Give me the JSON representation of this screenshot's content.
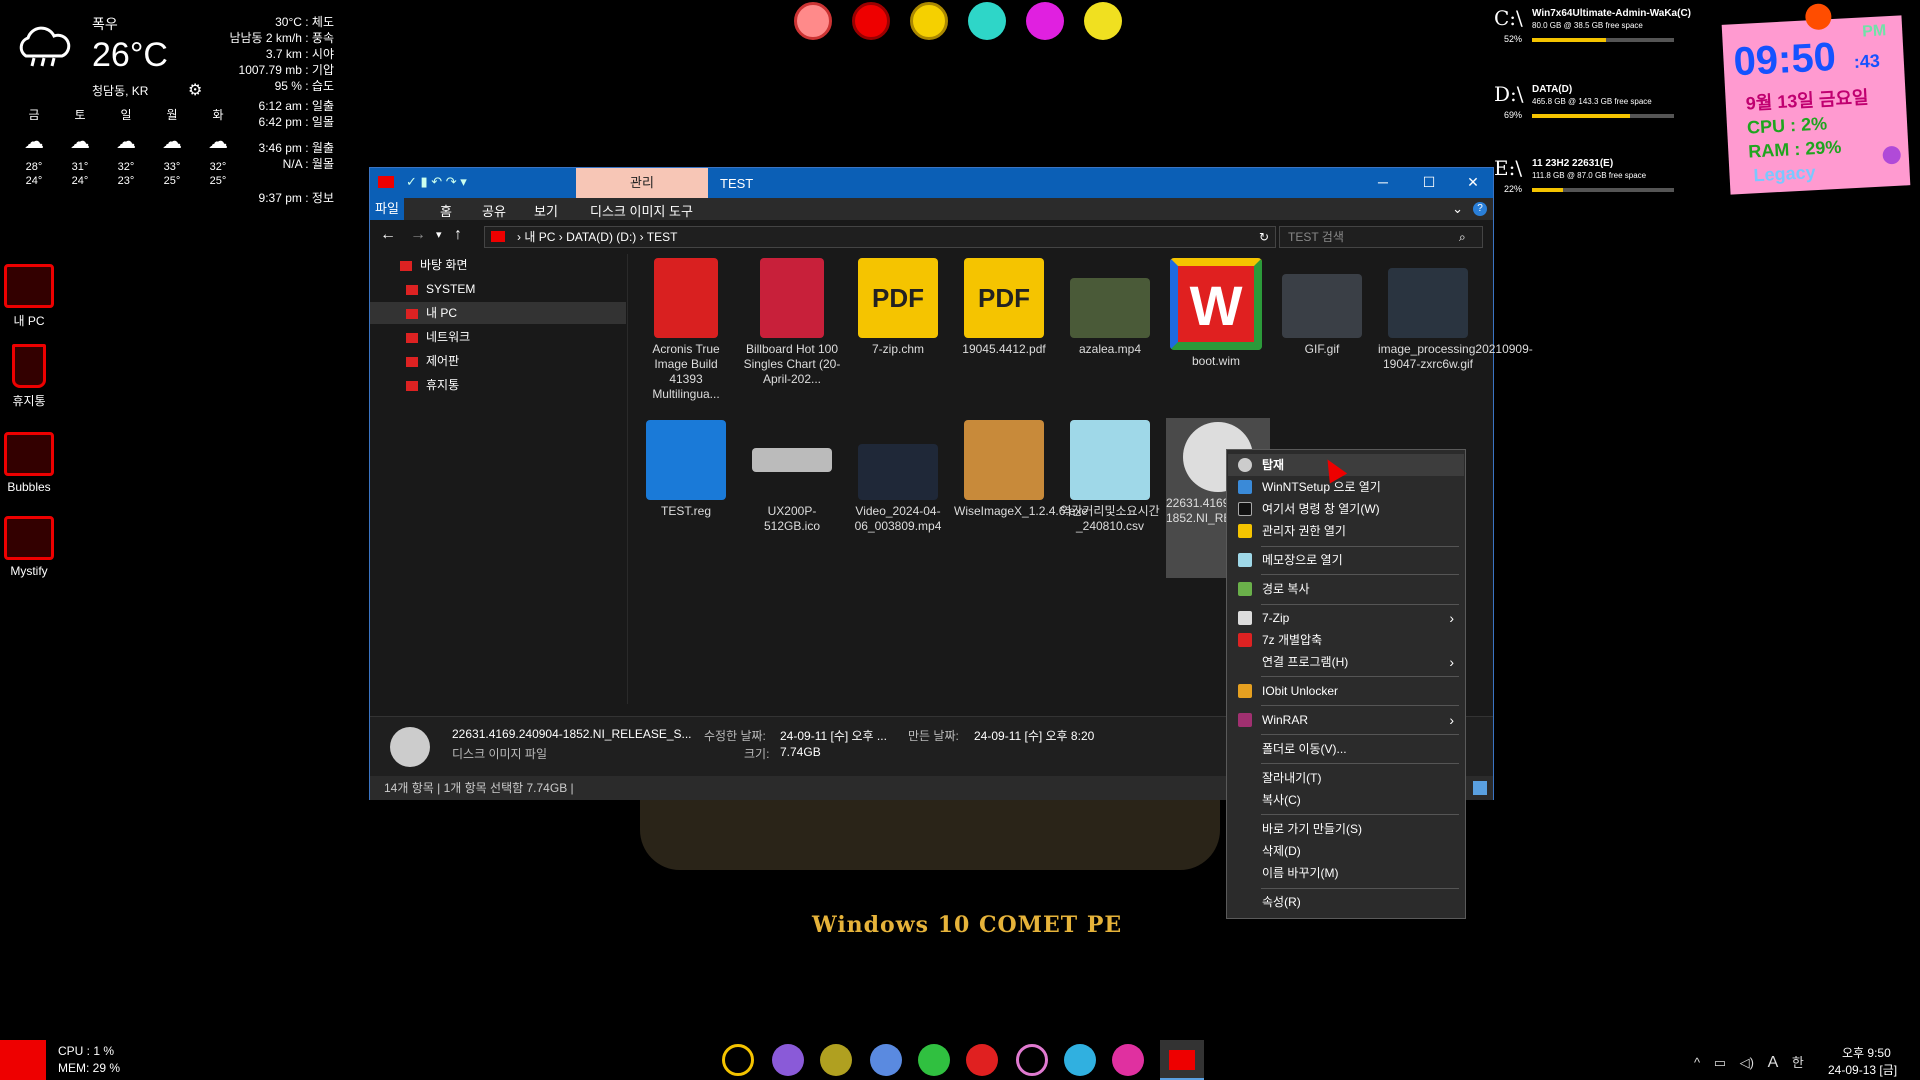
{
  "weather": {
    "condition": "폭우",
    "temperature": "26°C",
    "location": "청담동, KR",
    "details": [
      "30°C : 체도",
      "남남동 2 km/h : 풍속",
      "3.7 km : 시야",
      "1007.79 mb : 기압",
      "95 % : 습도"
    ],
    "sun": [
      "6:12 am : 일출",
      "6:42 pm : 일몰",
      "3:46 pm : 월출",
      "N/A : 월몰",
      "9:37 pm : 정보"
    ],
    "forecast": [
      {
        "day": "금",
        "high": "28°",
        "low": "24°"
      },
      {
        "day": "토",
        "high": "31°",
        "low": "24°"
      },
      {
        "day": "일",
        "high": "32°",
        "low": "23°"
      },
      {
        "day": "월",
        "high": "33°",
        "low": "25°"
      },
      {
        "day": "화",
        "high": "32°",
        "low": "25°"
      }
    ]
  },
  "desktop_icons": [
    "내 PC",
    "휴지통",
    "Bubbles",
    "Mystify"
  ],
  "drives": [
    {
      "letter": "C:\\",
      "name": "Win7x64Ultimate-Admin-WaKa(C)",
      "space": "80.0 GB @ 38.5 GB free space",
      "pct": "52%",
      "fill": 0.52
    },
    {
      "letter": "D:\\",
      "name": "DATA(D)",
      "space": "465.8 GB @ 143.3 GB free space",
      "pct": "69%",
      "fill": 0.69
    },
    {
      "letter": "E:\\",
      "name": "11 23H2 22631(E)",
      "space": "111.8 GB @ 87.0 GB free space",
      "pct": "22%",
      "fill": 0.22
    }
  ],
  "sticky": {
    "time": "09:50",
    "ampm": "PM",
    "seconds": ":43",
    "date": "9월 13일 금요일",
    "cpu": "CPU : 2%",
    "ram": "RAM : 29%",
    "theme": "Legacy"
  },
  "window": {
    "manage_tab": "관리",
    "title": "TEST",
    "ribbon_tabs": [
      "파일",
      "홈",
      "공유",
      "보기",
      "디스크 이미지 도구"
    ],
    "breadcrumb": [
      "내 PC",
      "DATA(D) (D:)",
      "TEST"
    ],
    "search_placeholder": "TEST 검색",
    "nav": [
      "바탕 화면",
      "SYSTEM",
      "내 PC",
      "네트워크",
      "제어판",
      "휴지통"
    ],
    "files": [
      "Acronis True Image Build 41393 Multilingua...",
      "Billboard Hot 100 Singles Chart (20-April-202...",
      "7-zip.chm",
      "19045.4412.pdf",
      "azalea.mp4",
      "boot.wim",
      "GIF.gif",
      "image_processing20210909-19047-zxrc6w.gif",
      "TEST.reg",
      "UX200P-512GB.ico",
      "Video_2024-04-06_003809.mp4",
      "WiseImageX_1.2.4.6.exe",
      "역간거리및소요시간_240810.csv",
      "22631.4169.240904-1852.NI_RELEASE_SVC_PROD1_CLIENT..."
    ],
    "details": {
      "name": "22631.4169.240904-1852.NI_RELEASE_S...",
      "type": "디스크 이미지 파일",
      "modified_label": "수정한 날짜:",
      "modified": "24-09-11 [수] 오후 ...",
      "created_label": "만든 날짜:",
      "created": "24-09-11 [수] 오후 8:20",
      "size_label": "크기:",
      "size": "7.74GB"
    },
    "status": "14개 항목  |  1개 항목 선택함 7.74GB  |"
  },
  "context_menu": [
    "탑재",
    "WinNTSetup 으로 열기",
    "여기서 명령 창 열기(W)",
    "관리자 권한 열기",
    "메모장으로 열기",
    "경로 복사",
    "7-Zip",
    "7z 개별압축",
    "연결 프로그램(H)",
    "IObit Unlocker",
    "WinRAR",
    "폴더로 이동(V)...",
    "잘라내기(T)",
    "복사(C)",
    "바로 가기 만들기(S)",
    "삭제(D)",
    "이름 바꾸기(M)",
    "속성(R)"
  ],
  "wallpaper_caption": "Windows 10 COMET PE",
  "taskbar": {
    "cpu": "CPU :  1 %",
    "mem": "MEM: 29 %",
    "time": "오후 9:50",
    "date": "24-09-13 [금]",
    "ime": "A",
    "lang": "한"
  },
  "colors": {
    "accent": "#0b5fb6",
    "drive_fill": "#f5c400",
    "sticky": "#ff9ad0",
    "brand_red": "#e00000"
  }
}
